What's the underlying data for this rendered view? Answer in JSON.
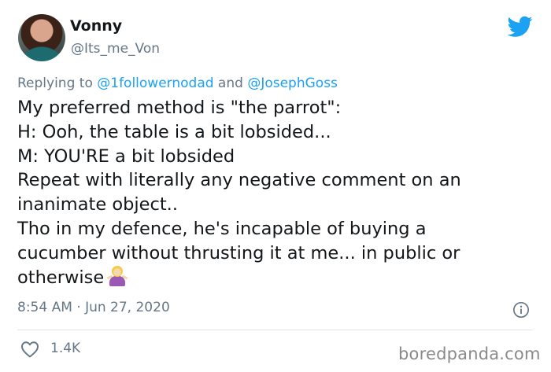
{
  "author": {
    "display_name": "Vonny",
    "handle": "@Its_me_Von"
  },
  "reply": {
    "prefix": "Replying to ",
    "mention1": "@1followernodad",
    "joiner": " and ",
    "mention2": "@JosephGoss"
  },
  "tweet": {
    "lines": [
      "My preferred method is \"the parrot\":",
      "H: Ooh, the table is a bit lobsided...",
      "M: YOU'RE a bit lobsided",
      "Repeat with literally any negative comment on an",
      "inanimate object..",
      "Tho in my defence, he's incapable of buying a",
      "cucumber without thrusting it at me... in public or",
      "otherwise"
    ],
    "emoji": "woman-shrugging-emoji"
  },
  "meta": {
    "timestamp": "8:54 AM · Jun 27, 2020"
  },
  "engagement": {
    "likes": "1.4K"
  },
  "watermark": "boredpanda.com",
  "colors": {
    "twitter_blue": "#1da1f2",
    "secondary_text": "#657786",
    "primary_text": "#14171a",
    "divider": "#e1e8ed"
  }
}
